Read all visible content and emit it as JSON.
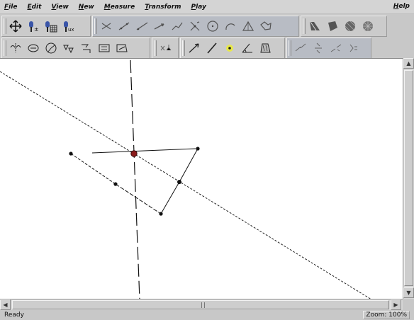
{
  "menu": {
    "items": [
      "File",
      "Edit",
      "View",
      "New",
      "Measure",
      "Transform",
      "Play"
    ],
    "help": "Help"
  },
  "toolbar": {
    "row1_group1": [
      "move-icon",
      "add-point-icon",
      "add-grid-icon",
      "unit-point-icon"
    ],
    "row1_group1_labels": [
      "",
      "±",
      "",
      "ux"
    ],
    "row1_group2": [
      "segment-tool-icon",
      "line-tool-icon",
      "ray-tool-icon",
      "vector-tool-icon",
      "polyline-tool-icon",
      "bisector-tool-icon",
      "circle-tool-icon",
      "arc-tool-icon",
      "triangle-tool-icon",
      "polygon-tool-icon"
    ],
    "row1_group3": [
      "fill-pattern-icon",
      "shade-polygon-icon",
      "shade-circle-icon",
      "shade-sector-icon"
    ],
    "row2_group1": [
      "reflect-tool-icon",
      "rotate-tool-icon",
      "dilate-tool-icon",
      "translate-tool-icon",
      "transform-vector-icon",
      "matrix-tool-icon",
      "zoom-tool-icon"
    ],
    "row2_group2": [
      "coordinate-icon"
    ],
    "row2_group3": [
      "slope-arrow-icon",
      "line-measure-icon",
      "point-on-object-icon",
      "angle-measure-icon",
      "area-measure-icon"
    ],
    "row2_group4": [
      "ratio-tool-icon",
      "fraction-tool-icon",
      "derivative-tool-icon",
      "formula-tool-icon"
    ]
  },
  "status": {
    "text": "Ready",
    "zoom": "Zoom: 100%"
  },
  "colors": {
    "selected_point": "#8b1a1a",
    "canvas": "#ffffff",
    "chrome": "#c8c8c8"
  }
}
